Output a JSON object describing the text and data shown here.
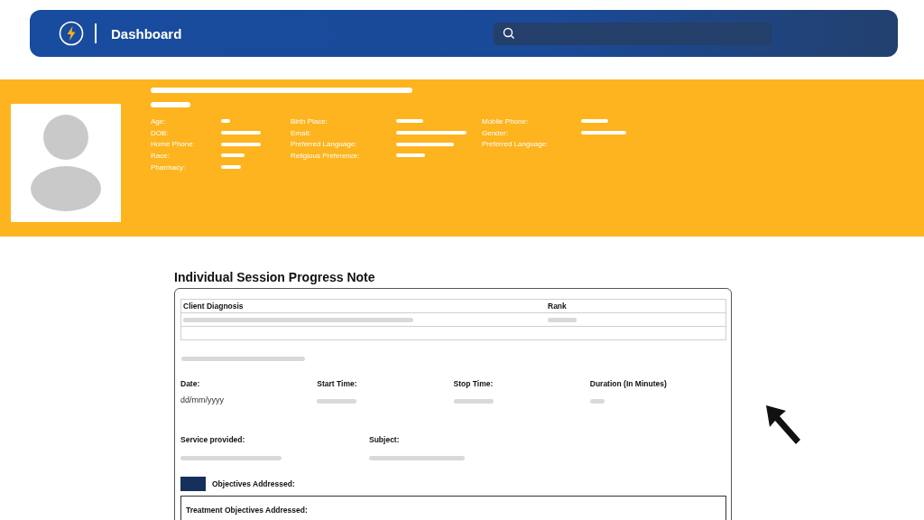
{
  "header": {
    "title": "Dashboard"
  },
  "profile": {
    "columns": [
      [
        {
          "label": "Age:"
        },
        {
          "label": "DOB:"
        },
        {
          "label": "Home Phone:"
        },
        {
          "label": "Race:"
        },
        {
          "label": "Pharmacy:"
        }
      ],
      [
        {
          "label": "Birth Place:"
        },
        {
          "label": "Email:"
        },
        {
          "label": "Preferred Language:"
        },
        {
          "label": "Religious Preference:"
        }
      ],
      [
        {
          "label": "Mobile Phone:"
        },
        {
          "label": "Gender:"
        },
        {
          "label": "Preferred Language:"
        }
      ]
    ]
  },
  "form": {
    "title": "Individual Session Progress Note",
    "diagnosis_table": {
      "columns": [
        "Client Diagnosis",
        "Rank"
      ]
    },
    "fields": [
      {
        "label": "Date:",
        "value": "dd/mm/yyyy"
      },
      {
        "label": "Start Time:"
      },
      {
        "label": "Stop Time:"
      },
      {
        "label": "Duration (In Minutes)"
      }
    ],
    "service_fields": [
      {
        "label": "Service provided:"
      },
      {
        "label": "Subject:"
      }
    ],
    "objectives": {
      "label": "Objectives Addressed:"
    },
    "treatment": {
      "label": "Treatment Objectives Addressed:"
    }
  }
}
